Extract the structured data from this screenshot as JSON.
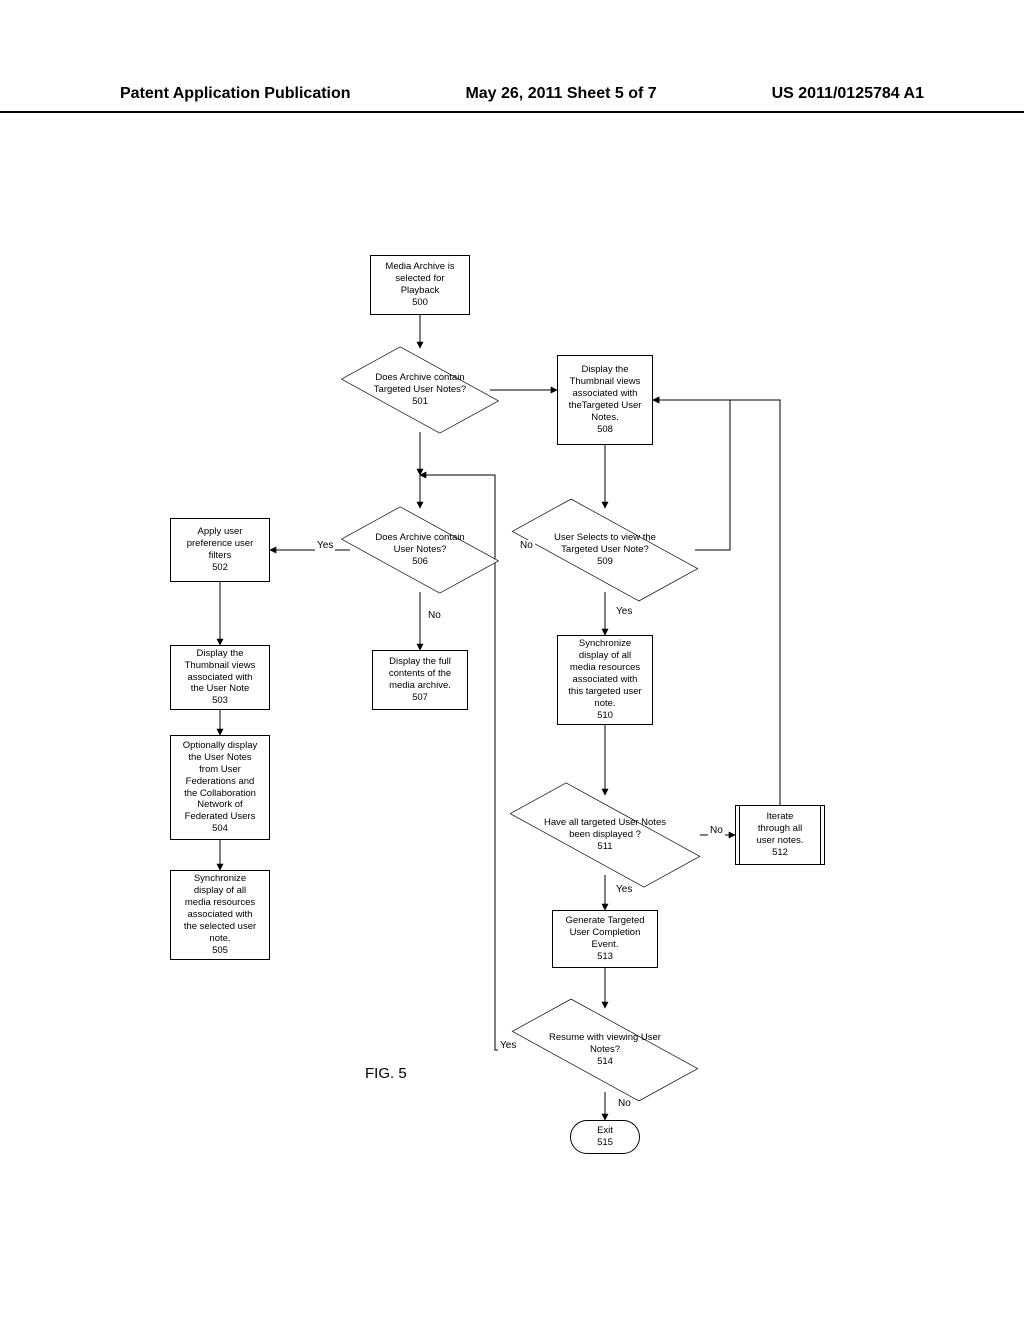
{
  "header": {
    "left": "Patent Application Publication",
    "center": "May 26, 2011  Sheet 5 of 7",
    "right": "US 2011/0125784 A1"
  },
  "figure_caption": "FIG. 5",
  "nodes": {
    "n500": "Media Archive is\nselected for\nPlayback\n500",
    "n501": "Does Archive contain\nTargeted User Notes?\n501",
    "n502": "Apply user\npreference user\nfilters\n502",
    "n503": "Display the\nThumbnail views\nassociated with\nthe User Note\n503",
    "n504": "Optionally display\nthe User Notes\nfrom User\nFederations and\nthe Collaboration\nNetwork of\nFederated Users\n504",
    "n505": "Synchronize\ndisplay of all\nmedia resources\nassociated with\nthe selected user\nnote.\n505",
    "n506": "Does Archive contain\nUser Notes?\n506",
    "n507": "Display the full\ncontents of the\nmedia archive.\n507",
    "n508": "Display the\nThumbnail views\nassociated with\ntheTargeted User\nNotes.\n508",
    "n509": "User Selects to view the\nTargeted User Note?\n509",
    "n510": "Synchronize\ndisplay of all\nmedia resources\nassociated with\nthis targeted user\nnote.\n510",
    "n511": "Have all targeted User Notes\nbeen displayed ?\n511",
    "n512": "Iterate\nthrough all\nuser notes.\n512",
    "n513": "Generate Targeted\nUser Completion\nEvent.\n513",
    "n514": "Resume with viewing User\nNotes?\n514",
    "n515": "Exit\n515"
  },
  "edge_labels": {
    "yes506": "Yes",
    "no506": "No",
    "no509": "No",
    "yes509": "Yes",
    "no511": "No",
    "yes511": "Yes",
    "yes514": "Yes",
    "no514": "No"
  }
}
